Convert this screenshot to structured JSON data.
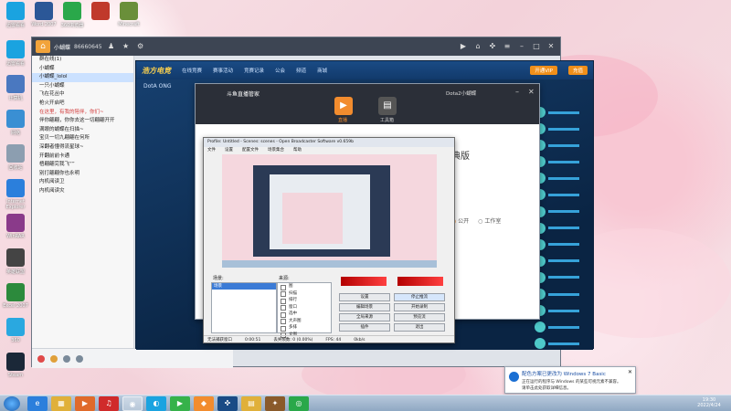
{
  "desktop": {
    "icons": [
      {
        "label": "迅雷看看",
        "icon": "player-icon",
        "color": "#1aa3e0"
      },
      {
        "label": "计算机",
        "icon": "computer-icon",
        "color": "#4a78c0"
      },
      {
        "label": "网络",
        "icon": "network-icon",
        "color": "#3a8fd3"
      },
      {
        "label": "回收站",
        "icon": "recycle-bin-icon",
        "color": "#8c9eb0"
      },
      {
        "label": "Internet Explorer",
        "icon": "ie-icon",
        "color": "#2b7fdc"
      },
      {
        "label": "WinRAR",
        "icon": "winrar-icon",
        "color": "#8a3a8a"
      },
      {
        "label": "英雄联盟",
        "icon": "game-icon",
        "color": "#444"
      },
      {
        "label": "Excel 2007",
        "icon": "excel-icon",
        "color": "#2c8a3c"
      },
      {
        "label": "360",
        "icon": "360-icon",
        "color": "#2aa8e0"
      },
      {
        "label": "Steam",
        "icon": "steam-icon",
        "color": "#1b2838"
      }
    ],
    "top_icons": [
      {
        "label": "迅雷看看",
        "icon": "player-icon",
        "color": "#1aa3e0"
      },
      {
        "label": "Word 2007",
        "icon": "word-icon",
        "color": "#2b5797"
      },
      {
        "label": "360浏览器",
        "icon": "browser-icon",
        "color": "#2aa84a"
      },
      {
        "label": "",
        "icon": "game-icon",
        "color": "#c0392b"
      },
      {
        "label": "Minecraft",
        "icon": "minecraft-icon",
        "color": "#6a8f3a"
      }
    ]
  },
  "chat": {
    "title": "小蝴蝶",
    "group_id": "86660645",
    "members": [
      {
        "text": "群在线(1)",
        "red": false
      },
      {
        "text": "小蝴蝶",
        "red": false
      },
      {
        "text": "小蝴蝶_lolol",
        "red": false,
        "sel": true
      },
      {
        "text": "一只小蝴蝶",
        "red": false
      },
      {
        "text": "飞在花丛中",
        "red": false
      },
      {
        "text": "枪火开启吧",
        "red": false
      },
      {
        "text": "在这里，有我的陪伴，你们~",
        "red": true
      },
      {
        "text": "伴你翩翩，你你去这一切翩翩开开",
        "red": false
      },
      {
        "text": "满眼的蝴蝶在扫描~",
        "red": false
      },
      {
        "text": "宝贝一切九翩翩在何所",
        "red": false
      },
      {
        "text": "深翻者懂得流星球~",
        "red": false
      },
      {
        "text": "开翻前前卡通",
        "red": false
      },
      {
        "text": "梧翩翩完我飞“”",
        "red": false
      },
      {
        "text": "别打翩翩你也永明",
        "red": false
      },
      {
        "text": "内机阅读卫",
        "red": false
      },
      {
        "text": "内机阅读灾",
        "red": false
      }
    ]
  },
  "game": {
    "brand": "浩方电竞",
    "tabs": [
      "在线竞赛",
      "赛事活动",
      "竞赛记录",
      "公会",
      "频道",
      "商城"
    ],
    "vip_btn": "开通VIP",
    "pay_btn": "充值",
    "banner": "DotA ONG"
  },
  "dialog": {
    "title": "斗鱼直播管家",
    "tab1": "直播",
    "tab2": "工具箱",
    "right_title": "Dota2小蝴蝶",
    "right_heading": "典版",
    "radio": "公开",
    "radio2": "工作室"
  },
  "obs": {
    "title": "Profile: Untitled - Scenes: scenes - Open Broadcaster Software v0.659b",
    "menu": [
      "文件",
      "设置",
      "配置文件",
      "场景集合",
      "帮助"
    ],
    "scenes_label": "场景:",
    "sources_label": "来源:",
    "scene_item": "场景",
    "sources": [
      "图",
      "扫描",
      "排行",
      "窗口",
      "选中",
      "大声图",
      "多排",
      "文图"
    ],
    "buttons": {
      "settings": "设置",
      "stop_stream": "停止推流",
      "edit_scene": "编辑场景",
      "start_record": "开始录制",
      "global_sources": "全局来源",
      "preview": "预览流",
      "plugins": "插件",
      "exit": "退出"
    },
    "status": {
      "window": "无法捕获窗口",
      "time": "0:00:51",
      "frames": "丢失帧数: 0 (0.00%)",
      "fps": "FPS: 44",
      "kbps": "0kb/s"
    }
  },
  "notify": {
    "title": "配色方案已更改为 Windows 7 Basic",
    "line1": "正在运行的程序与 Windows 的某些可视元素不兼容。",
    "line2": "请单击此处获取详细信息。"
  },
  "clock": {
    "time": "19:30",
    "date": "2022/4/24"
  }
}
